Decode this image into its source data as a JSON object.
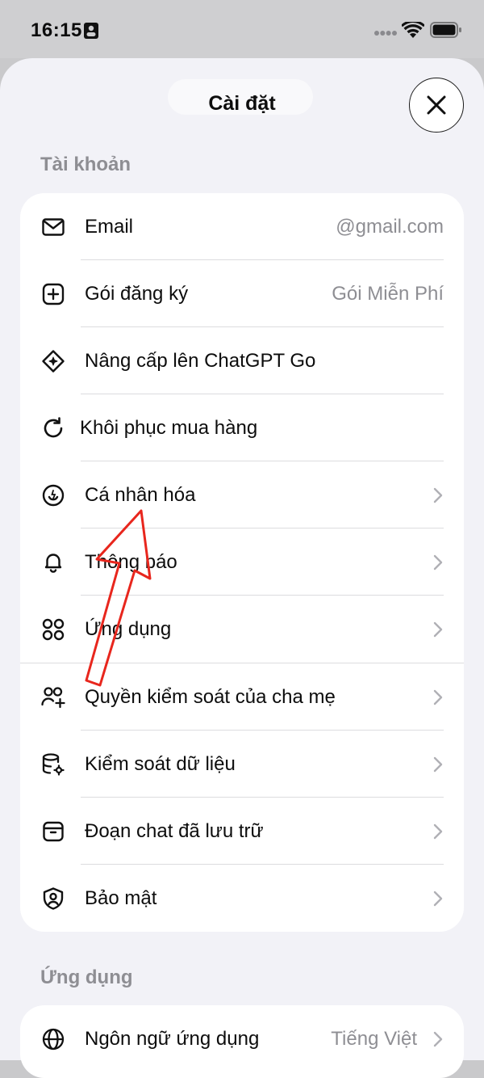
{
  "status": {
    "time": "16:15"
  },
  "header": {
    "title": "Cài đặt"
  },
  "sections": {
    "account": {
      "title": "Tài khoản",
      "items": [
        {
          "label": "Email",
          "value": "@gmail.com"
        },
        {
          "label": "Gói đăng ký",
          "value": "Gói Miễn Phí"
        },
        {
          "label": "Nâng cấp lên ChatGPT Go"
        },
        {
          "label": "Khôi phục mua hàng"
        },
        {
          "label": "Cá nhân hóa"
        },
        {
          "label": "Thông báo"
        },
        {
          "label": "Ứng dụng"
        },
        {
          "label": "Quyền kiểm soát của cha mẹ"
        },
        {
          "label": "Kiểm soát dữ liệu"
        },
        {
          "label": "Đoạn chat đã lưu trữ"
        },
        {
          "label": "Bảo mật"
        }
      ]
    },
    "app": {
      "title": "Ứng dụng",
      "items": [
        {
          "label": "Ngôn ngữ ứng dụng",
          "value": "Tiếng Việt"
        }
      ]
    }
  },
  "colors": {
    "annotation_arrow": "#e8261d",
    "secondary_text": "#8e8e93"
  }
}
